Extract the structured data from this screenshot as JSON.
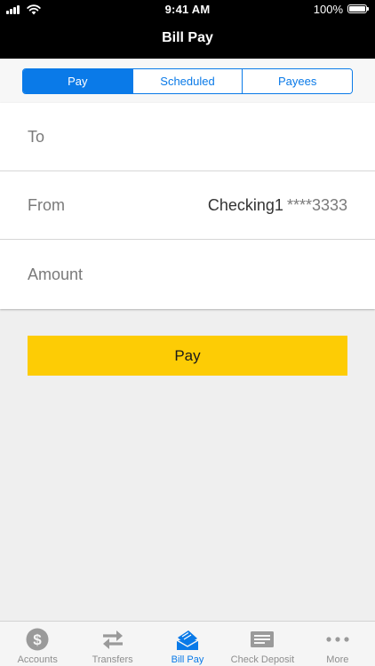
{
  "status_bar": {
    "time": "9:41 AM",
    "battery_percent": "100%"
  },
  "nav": {
    "title": "Bill Pay"
  },
  "segments": [
    {
      "label": "Pay",
      "active": true
    },
    {
      "label": "Scheduled",
      "active": false
    },
    {
      "label": "Payees",
      "active": false
    }
  ],
  "form": {
    "to_label": "To",
    "from_label": "From",
    "from_account_name": "Checking1",
    "from_account_mask": "****3333",
    "amount_label": "Amount"
  },
  "pay_button": {
    "label": "Pay"
  },
  "tabbar": {
    "items": [
      {
        "label": "Accounts",
        "icon": "dollar-circle-icon",
        "active": false
      },
      {
        "label": "Transfers",
        "icon": "transfer-arrows-icon",
        "active": false
      },
      {
        "label": "Bill Pay",
        "icon": "bill-pay-icon",
        "active": true
      },
      {
        "label": "Check Deposit",
        "icon": "check-icon",
        "active": false
      },
      {
        "label": "More",
        "icon": "more-dots-icon",
        "active": false
      }
    ]
  },
  "colors": {
    "accent": "#0a7ae8",
    "button": "#fdcc05",
    "header": "#000000",
    "background": "#efefef"
  }
}
